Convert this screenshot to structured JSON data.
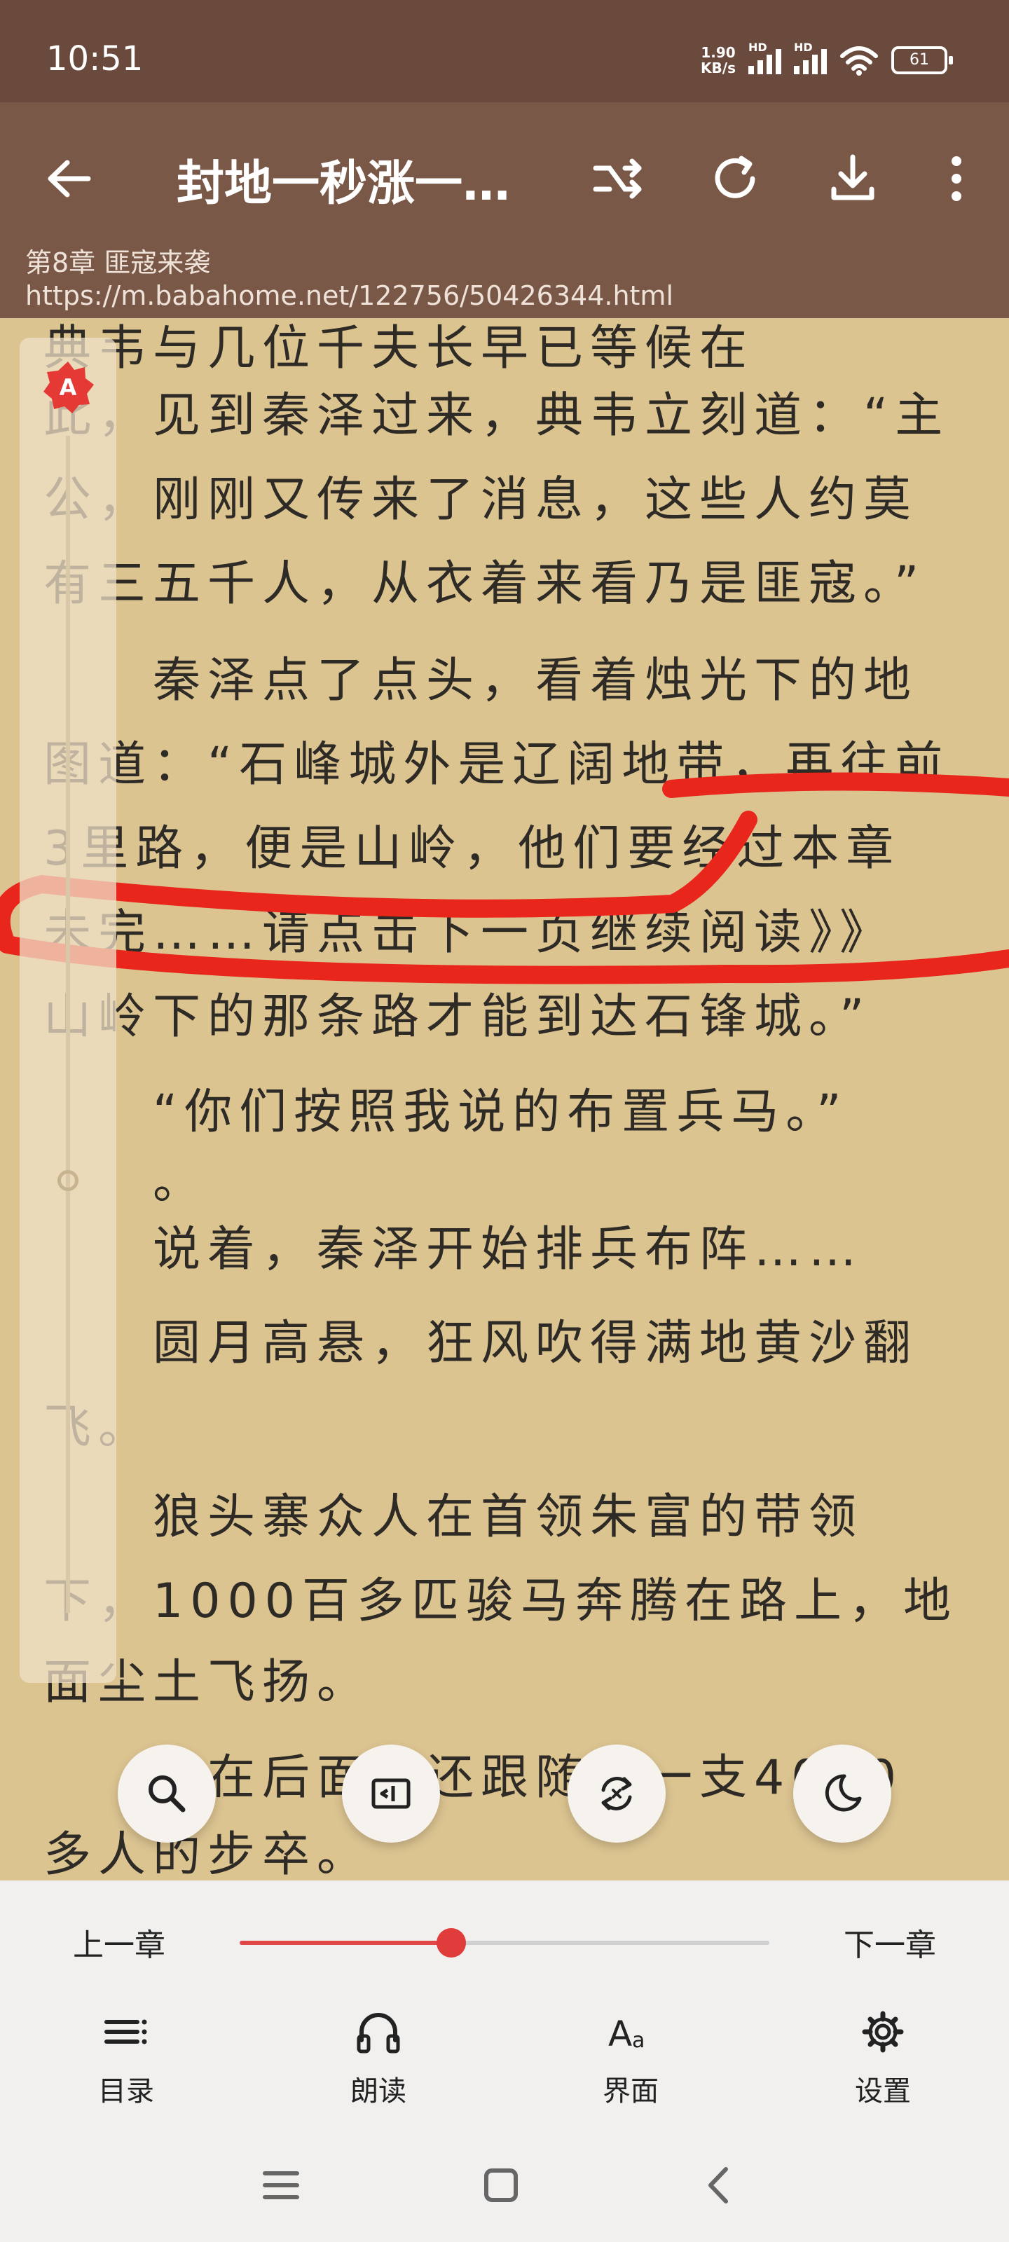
{
  "status_bar": {
    "time": "10:51",
    "net_speed_value": "1.90",
    "net_speed_unit": "KB/s",
    "hd1": "HD",
    "hd2": "HD",
    "battery": "61"
  },
  "top_bar": {
    "title": "封地一秒涨一…",
    "chapter": "第8章 匪寇来袭",
    "url": "https://m.babahome.net/122756/50426344.html"
  },
  "content": {
    "lines": [
      "典韦与几位千夫长早已等候在",
      "此，见到秦泽过来，典韦立刻道：“主",
      "公，刚刚又传来了消息，这些人约莫",
      "有三五千人，从衣着来看乃是匪寇。”",
      "　　秦泽点了点头，看着烛光下的地",
      "图道：“石峰城外是辽阔地带，再往前",
      "3里路，便是山岭，他们要经过本章",
      "未完……请点击下一页继续阅读》》",
      "山岭下的那条路才能到达石锋城。”",
      "　　“你们按照我说的布置兵马。”",
      "　　。",
      "　　说着，秦泽开始排兵布阵……",
      "　　圆月高悬，狂风吹得满地黄沙翻",
      "飞。",
      "",
      "　　狼头寨众人在首领朱富的带领",
      "下，1000百多匹骏马奔腾在路上，地",
      "面尘土飞扬。",
      "",
      "　　而在后面，还跟随着一支4000",
      "多人的步卒。"
    ]
  },
  "scroll": {
    "badge": "A"
  },
  "bottom": {
    "prev_chapter": "上一章",
    "next_chapter": "下一章",
    "progress": 0.4,
    "menu": {
      "toc": "目录",
      "read_aloud": "朗读",
      "interface": "界面",
      "settings": "设置"
    }
  },
  "colors": {
    "status_bg": "#6b4a3e",
    "topbar_bg": "#7a5848",
    "page_bg": "#dcc491",
    "accent_red": "#e03c3c",
    "annotation_red": "#e8261c"
  },
  "icons": {
    "back": "arrow-left-icon",
    "switch_source": "shuffle-icon",
    "refresh": "refresh-icon",
    "download": "download-icon",
    "more": "more-vertical-icon",
    "search": "search-icon",
    "auto_page": "auto-page-icon",
    "replace": "replace-icon",
    "night": "moon-icon"
  }
}
